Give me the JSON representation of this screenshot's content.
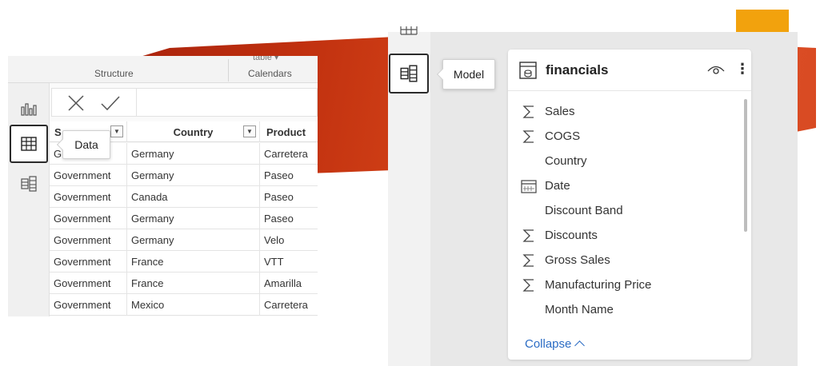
{
  "data_view": {
    "ribbon": {
      "group_structure": "Structure",
      "group_calendars": "Calendars",
      "peek_text": "table ▾"
    },
    "rail": {
      "report_icon": "report-view-icon",
      "data_icon": "data-view-icon",
      "model_icon": "model-view-icon"
    },
    "formula_bar": {
      "cancel_icon": "close-icon",
      "commit_icon": "checkmark-icon"
    },
    "tooltip": "Data",
    "grid": {
      "columns": [
        "Segment",
        "Country",
        "Product"
      ],
      "header_visible": [
        "S",
        "Country",
        "Product"
      ],
      "rows": [
        [
          "Government",
          "Germany",
          "Carretera"
        ],
        [
          "Government",
          "Germany",
          "Paseo"
        ],
        [
          "Government",
          "Canada",
          "Paseo"
        ],
        [
          "Government",
          "Germany",
          "Paseo"
        ],
        [
          "Government",
          "Germany",
          "Velo"
        ],
        [
          "Government",
          "France",
          "VTT"
        ],
        [
          "Government",
          "France",
          "Amarilla"
        ],
        [
          "Government",
          "Mexico",
          "Carretera"
        ]
      ],
      "first_row_visible_segment": [
        "G",
        "ent"
      ]
    }
  },
  "model_view": {
    "tooltip": "Model",
    "card": {
      "title": "financials",
      "fields": [
        {
          "label": "Sales",
          "icon": "sigma"
        },
        {
          "label": "COGS",
          "icon": "sigma"
        },
        {
          "label": "Country",
          "icon": ""
        },
        {
          "label": "Date",
          "icon": "calendar"
        },
        {
          "label": "Discount Band",
          "icon": ""
        },
        {
          "label": "Discounts",
          "icon": "sigma"
        },
        {
          "label": "Gross Sales",
          "icon": "sigma"
        },
        {
          "label": "Manufacturing Price",
          "icon": "sigma"
        },
        {
          "label": "Month Name",
          "icon": ""
        }
      ],
      "collapse_label": "Collapse",
      "more_glyph": "⋮"
    }
  },
  "colors": {
    "accent_orange": "#f2a20d",
    "slide_red": "#c0300f",
    "link_blue": "#2b6cc4"
  }
}
